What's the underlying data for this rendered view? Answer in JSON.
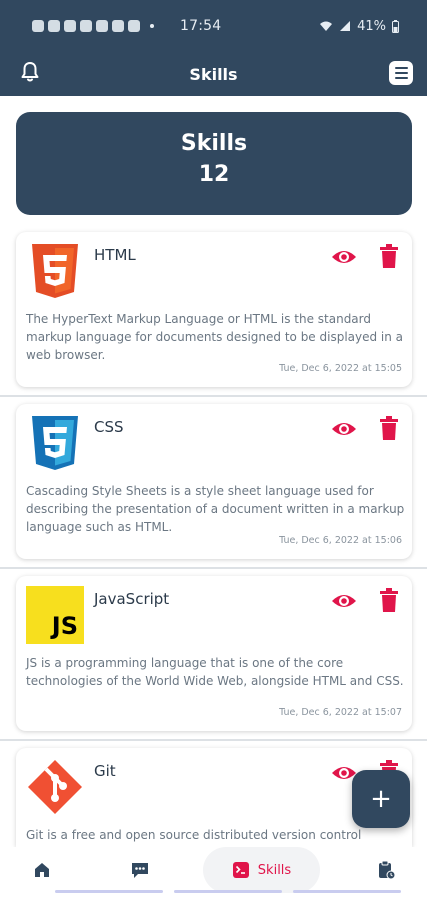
{
  "status_bar": {
    "time": "17:54",
    "battery": "41%"
  },
  "header": {
    "title": "Skills"
  },
  "summary": {
    "title": "Skills",
    "count": "12"
  },
  "skills": [
    {
      "name": "HTML",
      "logo_icon": "html5-logo-icon",
      "description": "The HyperText Markup Language or HTML is the standard markup language for documents designed to be displayed in a web browser.",
      "date": "Tue, Dec 6, 2022 at 15:05"
    },
    {
      "name": "CSS",
      "logo_icon": "css3-logo-icon",
      "description": "Cascading Style Sheets is a style sheet language used for describing the presentation of a document written in a markup language such as HTML.",
      "date": "Tue, Dec 6, 2022 at 15:06"
    },
    {
      "name": "JavaScript",
      "logo_icon": "javascript-logo-icon",
      "logo_text": "JS",
      "description": "JS is a programming language that is one of the core technologies of the World Wide Web, alongside HTML and CSS.",
      "date": "Tue, Dec 6, 2022 at 15:07"
    },
    {
      "name": "Git",
      "logo_icon": "git-logo-icon",
      "description": "Git is a free and open source distributed version control",
      "date": ""
    }
  ],
  "fab": {
    "icon": "plus-icon",
    "label": "+"
  },
  "bottom_nav": {
    "items": [
      {
        "icon": "home-icon"
      },
      {
        "icon": "chat-icon"
      },
      {
        "icon": "terminal-icon",
        "label": "Skills"
      },
      {
        "icon": "clipboard-icon"
      }
    ]
  },
  "colors": {
    "primary": "#31485f",
    "accent": "#e0154a",
    "html": "#e44d26",
    "css": "#1572b6",
    "js": "#f7df1e",
    "git": "#f05033"
  }
}
